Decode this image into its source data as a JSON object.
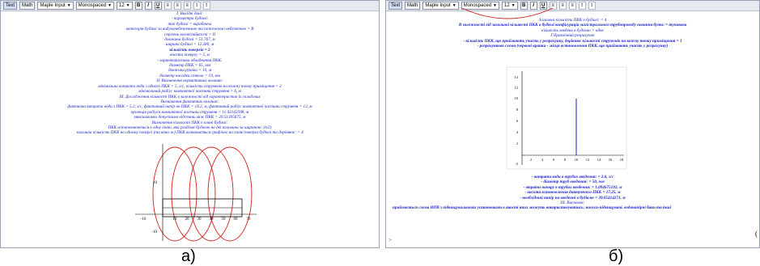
{
  "toolbar": {
    "text_btn": "Text",
    "math_btn": "Math",
    "style_select": "Maple Input",
    "font_select": "Monospaced",
    "size_select": "12",
    "bold": "B",
    "italic": "I",
    "underline": "U"
  },
  "panel_a": {
    "lines": [
      "І. Вихідні дані:",
      "- параметри будівлі:",
      "тип будівлі = виробнича",
      "категорія будівлі за вибухонебезпечною та пожежною небезпекою = В",
      "ступень вогнестійкості = ІІ",
      "довжина будівлі = 51.767, м",
      "ширина будівлі = 12.280, м",
      "кількість поверхів = 2",
      "висота поверху = 5, м",
      "- характеристики обладнання ПКК:",
      "діаметр ПКК = 65, мм",
      "довжина рукава = 10, м",
      "діаметр насадки ствола = 19, мм",
      "ІІ. Визначення нормативних величин:",
      "мінімальна витрата води з одного ПКК = 5, л/с, кількість струменів на кожну точку приміщення = 2",
      "мінімальний радіус компактної частини струменя = 6, м",
      "ІІІ. Дослідження кількості ПКК в залежності від характеристик їх складових",
      "Визначення фактичних величин:",
      "фактична витрата води з ПКК = 5.2, л/с, фактичний напір на ПКК = 18.2, м, фактичний радіус компактної частини струменя = 12, м",
      "проекція радіуса компактної частини струменя = 11.43142598, м",
      "максимально допустима відстань між ПКК = 20.51305675, м",
      "Визначення кількості ПКК в плані будівлі:",
      "ПКК встановлюються в одну лінію, яка розділяє будівлю на дві половини за шириною: (b/2)",
      "загальна кількість ПКК на одному поверсі (та вона ж) ПКК визначається графічно на плані поверха будівлі та дорівнює: = 4"
    ],
    "graph": {
      "y_ticks": [
        "10",
        "-10"
      ],
      "x_ticks": [
        "-10",
        "10",
        "20",
        "30",
        "40",
        "50",
        "60",
        "70"
      ]
    }
  },
  "panel_b": {
    "lines_top": [
      "Загальна кількість ПКК в будівлі: = 4",
      "В залежності від загальної кількості ПКК в будівлі конфігурація магістрального трубопроводу повинна бути: = тупикова",
      "кількість введень в будівлю = одне",
      "Гідравлічний розрахунок",
      "- кількість ПКК, що приймають участь у розрахунку, дорівнює кількості струменів на кожну точку приміщення = 1",
      "- розрахункова схема (червоні крапки - місця встановлення ПКК, що приймають участь у розрахунку)"
    ],
    "graph": {
      "y_ticks": [
        "14",
        "12",
        "10",
        "8",
        "6",
        "4",
        "2",
        "-2"
      ],
      "x_ticks": [
        "2",
        "4",
        "6",
        "8",
        "10",
        "12",
        "14",
        "16",
        "18"
      ]
    },
    "lines_bottom": [
      "- витрати води в трубах введення: = 2.6, л/с",
      "- діаметр труб введення: = 50, мм",
      "- втрати напору в трубах введення: = 1.094675192, м",
      "- висота встановлення диктуючого ПКК = 17.25, м",
      "- необхідний напір на введенні в будівлю = 39.05414271, м",
      "ІІІ. Висновок:"
    ],
    "conclusion": "приймається схема ВПВ з підвищувальними установками в якості яких можуть використовуватись: насоси-підвищувачі, водонапірні баки та інші",
    "prompt": ">"
  },
  "captions": {
    "a": "а)",
    "b": "б)"
  }
}
